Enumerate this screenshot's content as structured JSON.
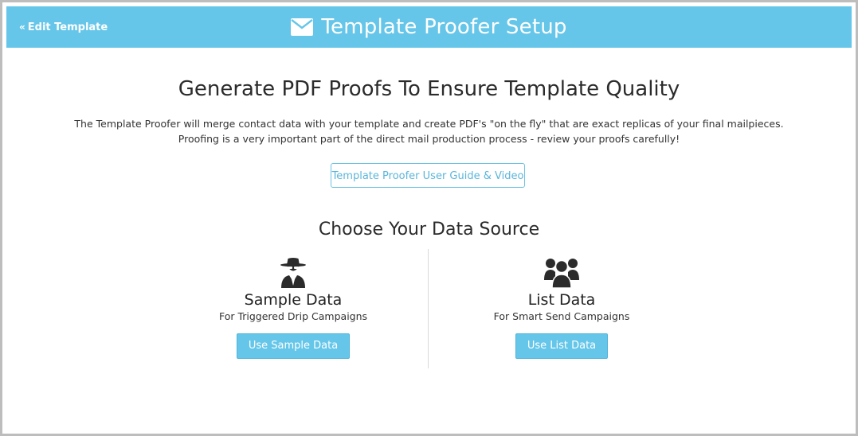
{
  "header": {
    "back_label": "Edit Template",
    "title": "Template Proofer Setup",
    "title_icon": "envelope-icon"
  },
  "main": {
    "headline": "Generate PDF Proofs To Ensure Template Quality",
    "intro_line1": "The Template Proofer will merge contact data with your template and create PDF's \"on the fly\" that are exact replicas of your final mailpieces.",
    "intro_line2": "Proofing is a very important part of the direct mail production process - review your proofs carefully!",
    "guide_button": "Template Proofer User Guide & Video",
    "choose_heading": "Choose Your Data Source"
  },
  "sources": [
    {
      "icon": "spy-icon",
      "title": "Sample Data",
      "subtitle": "For Triggered Drip Campaigns",
      "button": "Use Sample Data"
    },
    {
      "icon": "users-icon",
      "title": "List Data",
      "subtitle": "For Smart Send Campaigns",
      "button": "Use List Data"
    }
  ],
  "colors": {
    "header_bg": "#65c6e9",
    "accent": "#5bb6da",
    "text": "#2b2b2b"
  }
}
